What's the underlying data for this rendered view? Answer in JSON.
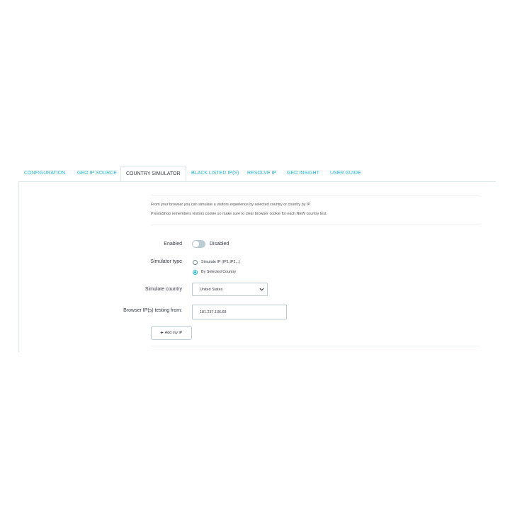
{
  "tabs": [
    {
      "label": "CONFIGURATION",
      "active": false
    },
    {
      "label": "GEO IP SOURCE",
      "active": false
    },
    {
      "label": "COUNTRY SIMULATOR",
      "active": true
    },
    {
      "label": "BLACK LISTED IP(S)",
      "active": false
    },
    {
      "label": "RESOLVE IP",
      "active": false
    },
    {
      "label": "GEO INSIGHT",
      "active": false
    },
    {
      "label": "USER GUIDE",
      "active": false
    }
  ],
  "info": {
    "line1": "From your browser you can simulate a visitors experience by selected country or country by IP.",
    "line2": "PrestaShop remembers visitors cookie so make sure to clear browser cookie for each NEW country test."
  },
  "form": {
    "enabled_label": "Enabled",
    "enabled_state": "Disabled",
    "simulator_type_label": "Simulator type",
    "simulator_options": [
      {
        "label": "Simulate IP (IP1,IP2,..)",
        "checked": false
      },
      {
        "label": "By Selected Country",
        "checked": true
      }
    ],
    "simulate_country_label": "Simulate country",
    "simulate_country_value": "United States",
    "browser_ip_label": "Browser IP(s) testing from:",
    "browser_ip_value": "181.237.136.68",
    "add_ip_label": "Add my IP"
  },
  "colors": {
    "accent": "#25b9d7",
    "text": "#363a41",
    "border": "#bbcdd2"
  },
  "icons": {
    "toggle": "toggle-switch-off",
    "select": "chevron-down-icon",
    "button": "plus-icon"
  }
}
